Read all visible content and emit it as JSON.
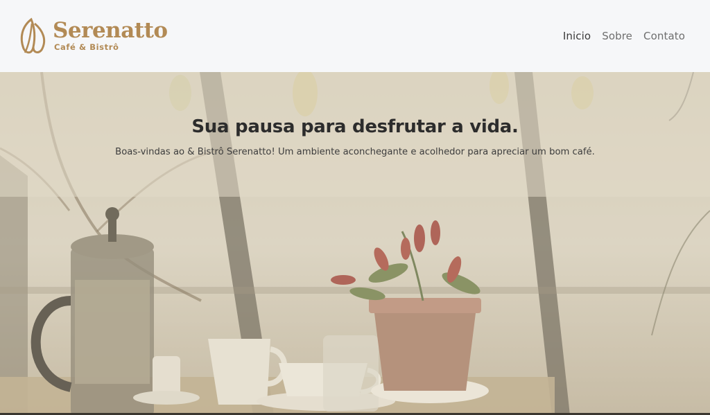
{
  "header": {
    "brand_name": "Serenatto",
    "tagline": "Café & Bistrô",
    "logo_icon": "leaf-logo-icon",
    "nav": [
      {
        "label": "Inicio",
        "active": true
      },
      {
        "label": "Sobre",
        "active": false
      },
      {
        "label": "Contato",
        "active": false
      }
    ]
  },
  "hero": {
    "title": "Sua pausa para desfrutar a vida.",
    "subtitle": "Boas-vindas ao & Bistrô Serenatto! Um ambiente aconchegante e acolhedor para apreciar um bom café."
  },
  "colors": {
    "brand": "#b28a55",
    "header_bg": "#f6f7f9",
    "title_text": "#2c2c2c"
  }
}
